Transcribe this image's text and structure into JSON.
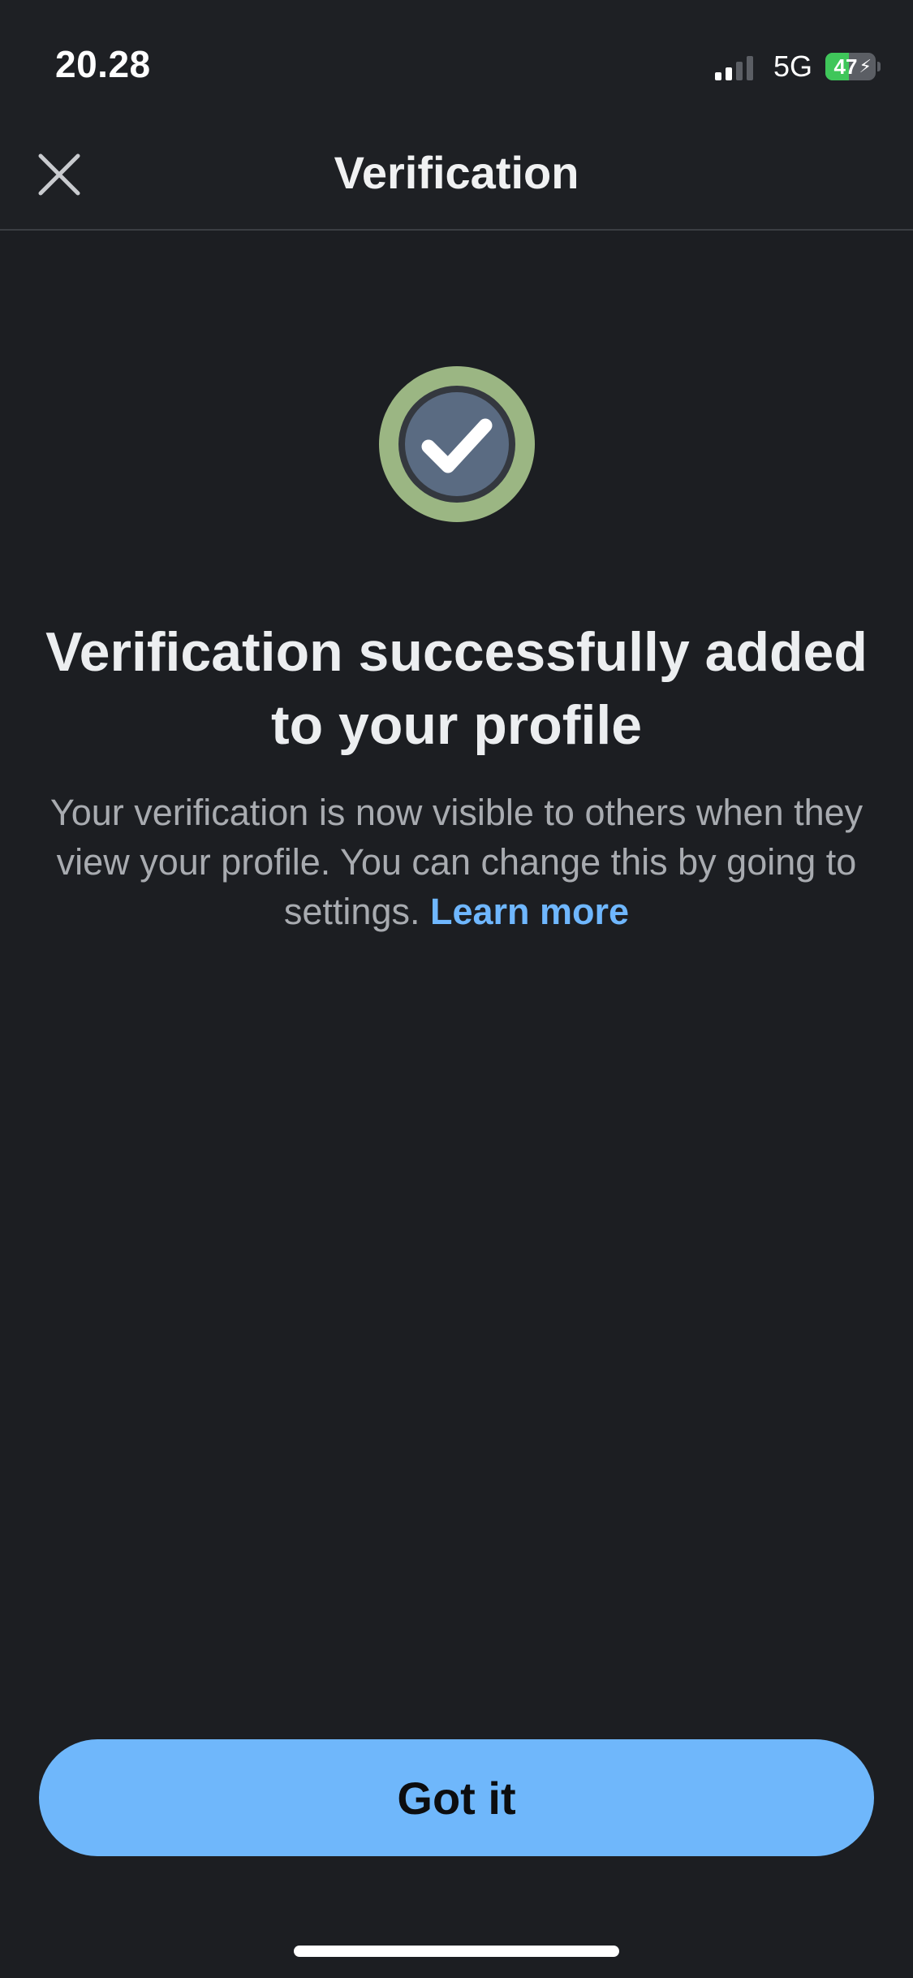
{
  "status_bar": {
    "time": "20.28",
    "network": "5G",
    "battery": "47",
    "battery_level": 0.47,
    "signal_bars_active": 2,
    "signal_bars_total": 4,
    "battery_color": "#3fc65a"
  },
  "header": {
    "title": "Verification",
    "close_icon": "close-icon"
  },
  "main": {
    "badge_icon": "verified-check-icon",
    "headline": "Verification successfully added to your profile",
    "body": "Your verification is now visible to others when they view your profile. You can change this by going to settings.",
    "learn_more": "Learn more"
  },
  "footer": {
    "button_label": "Got it"
  },
  "colors": {
    "background": "#1c1e22",
    "accent": "#6fb7fb",
    "link": "#6fb7ff",
    "badge_ring": "#9bb683",
    "badge_inner": "#5a6b82"
  }
}
